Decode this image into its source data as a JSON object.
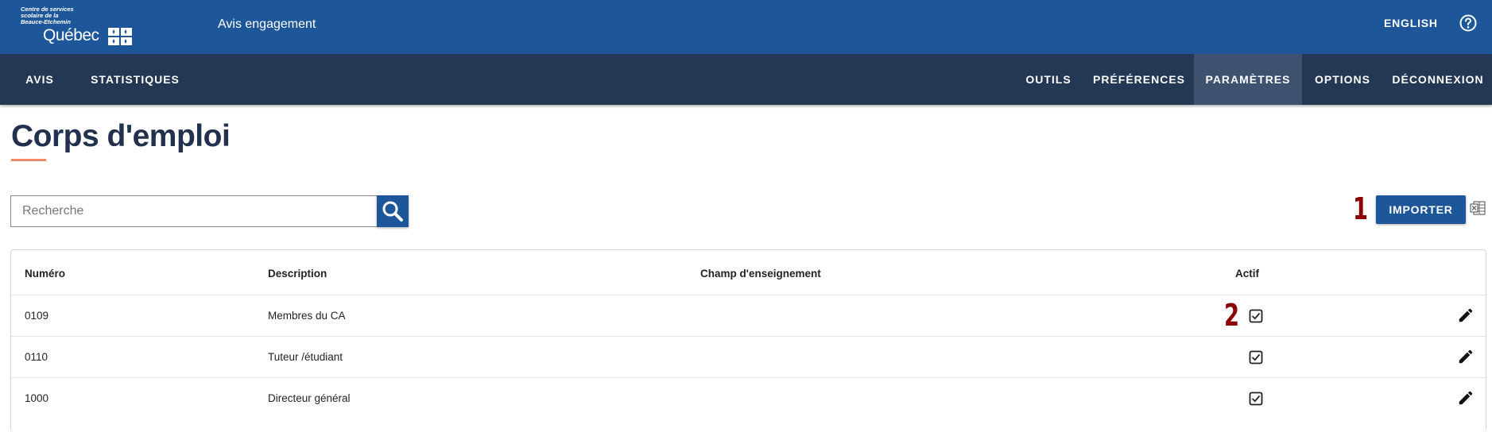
{
  "header": {
    "logo_small_text": "Centre de services\nscolaire de la\nBeauce-Etchemin",
    "logo_quebec_text": "Québec",
    "app_title": "Avis engagement",
    "language_link": "ENGLISH",
    "help_icon": "question-circle-icon"
  },
  "nav": {
    "left": [
      {
        "label": "AVIS"
      },
      {
        "label": "STATISTIQUES"
      }
    ],
    "right": [
      {
        "label": "OUTILS"
      },
      {
        "label": "PRÉFÉRENCES"
      },
      {
        "label": "PARAMÈTRES",
        "active": true
      },
      {
        "label": "OPTIONS"
      },
      {
        "label": "DÉCONNEXION"
      }
    ]
  },
  "page": {
    "title": "Corps d'emploi"
  },
  "search": {
    "placeholder": "Recherche",
    "value": "",
    "icon": "search-icon"
  },
  "annotations": {
    "import_marker": "1",
    "row_marker": "2"
  },
  "import": {
    "label": "IMPORTER",
    "icon": "excel-file-icon"
  },
  "table": {
    "columns": [
      "Numéro",
      "Description",
      "Champ d'enseignement",
      "Actif"
    ],
    "rows": [
      {
        "numero": "0109",
        "description": "Membres du CA",
        "champ": "",
        "actif": true
      },
      {
        "numero": "0110",
        "description": "Tuteur /étudiant",
        "champ": "",
        "actif": true
      },
      {
        "numero": "1000",
        "description": "Directeur général",
        "champ": "",
        "actif": true
      }
    ]
  },
  "colors": {
    "header_bg": "#1e5799",
    "nav_bg": "#243753",
    "nav_active_bg": "#3e5270",
    "primary_button": "#1e5799",
    "title_color": "#22314d",
    "title_underline": "#ee8866",
    "annotation_color": "#8b0000"
  }
}
